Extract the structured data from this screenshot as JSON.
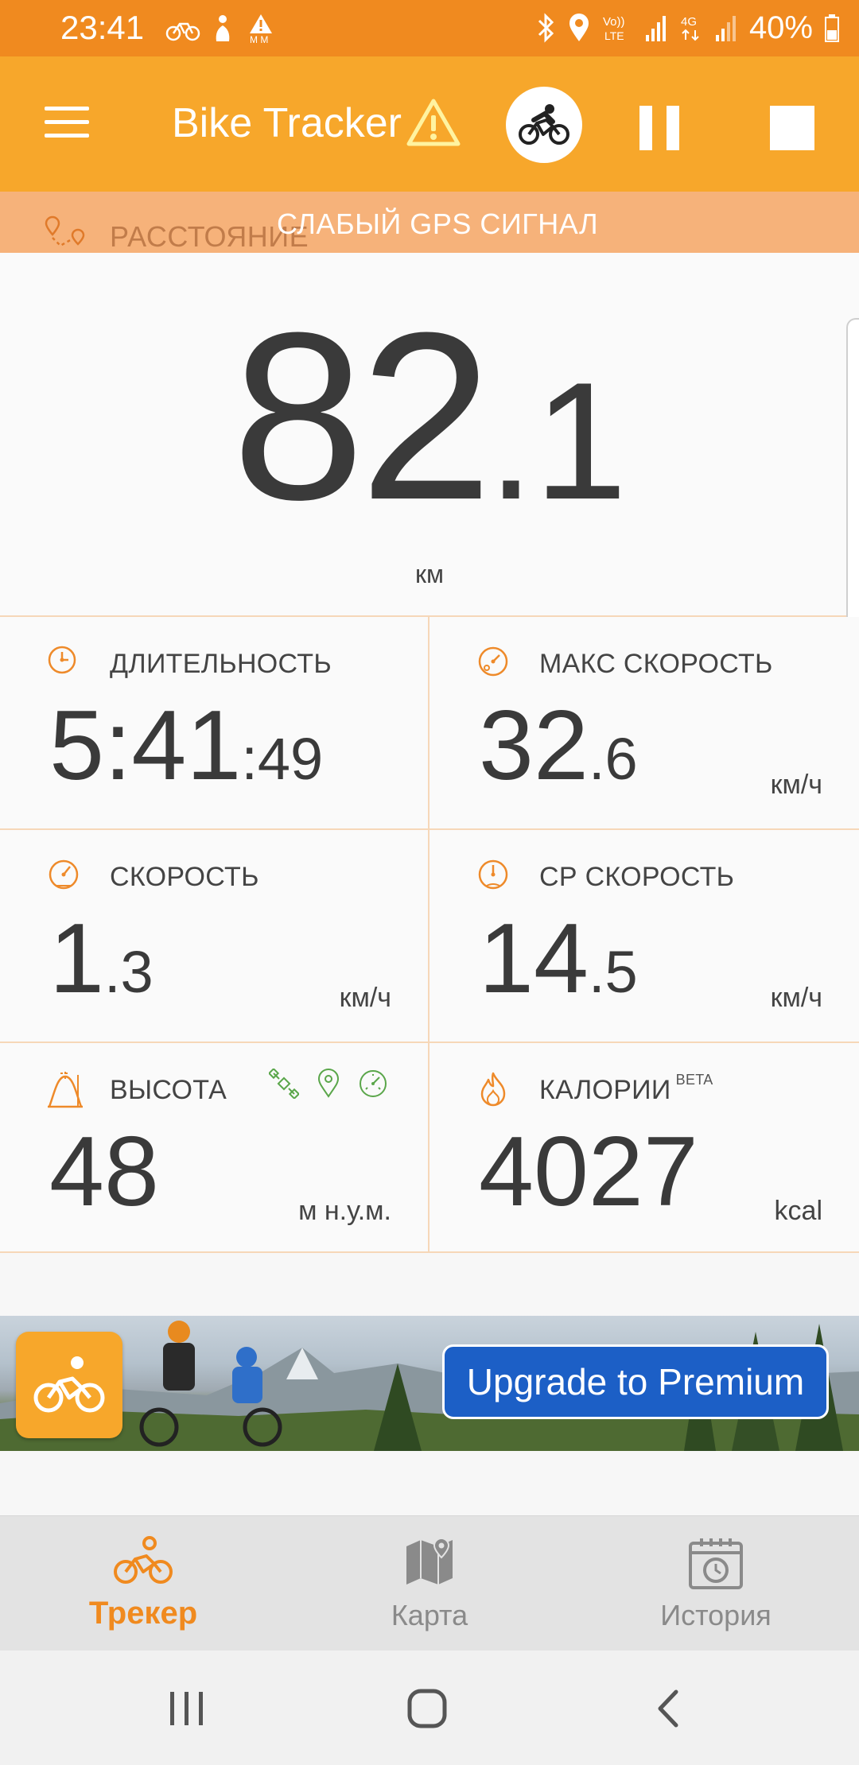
{
  "status_bar": {
    "time": "23:41",
    "battery": "40%",
    "network": "4G",
    "volte": "Vo)) LTE",
    "mm_label": "M M"
  },
  "app_bar": {
    "title": "Bike Tracker",
    "warning_icon": "warning-triangle-icon",
    "mode_icon": "cyclist-icon"
  },
  "gps_warning": {
    "text": "СЛАБЫЙ GPS СИГНАЛ",
    "underlay_label": "РАССТОЯНИЕ"
  },
  "distance": {
    "integer": "82",
    "fraction": ".1",
    "unit": "км"
  },
  "stats": {
    "duration": {
      "label": "ДЛИТЕЛЬНОСТЬ",
      "main": "5:41",
      "small": ":49"
    },
    "max_speed": {
      "label": "МАКС СКОРОСТЬ",
      "main": "32",
      "small": ".6",
      "unit": "км/ч"
    },
    "speed": {
      "label": "СКОРОСТЬ",
      "main": "1",
      "small": ".3",
      "unit": "км/ч"
    },
    "avg_speed": {
      "label": "СР СКОРОСТЬ",
      "main": "14",
      "small": ".5",
      "unit": "км/ч"
    },
    "altitude": {
      "label": "ВЫСОТА",
      "main": "48",
      "unit": "м н.у.м."
    },
    "calories": {
      "label": "КАЛОРИИ",
      "badge": "BETA",
      "main": "4027",
      "unit": "kcal"
    }
  },
  "banner": {
    "button": "Upgrade to Premium"
  },
  "bottom_nav": {
    "tabs": [
      {
        "label": "Трекер",
        "active": true
      },
      {
        "label": "Карта",
        "active": false
      },
      {
        "label": "История",
        "active": false
      }
    ]
  },
  "colors": {
    "accent": "#f7a72b",
    "status_bar": "#f08a1f",
    "icon_orange": "#ee8a2a",
    "source_green": "#5aa64a",
    "premium_blue": "#1c5fc6"
  }
}
